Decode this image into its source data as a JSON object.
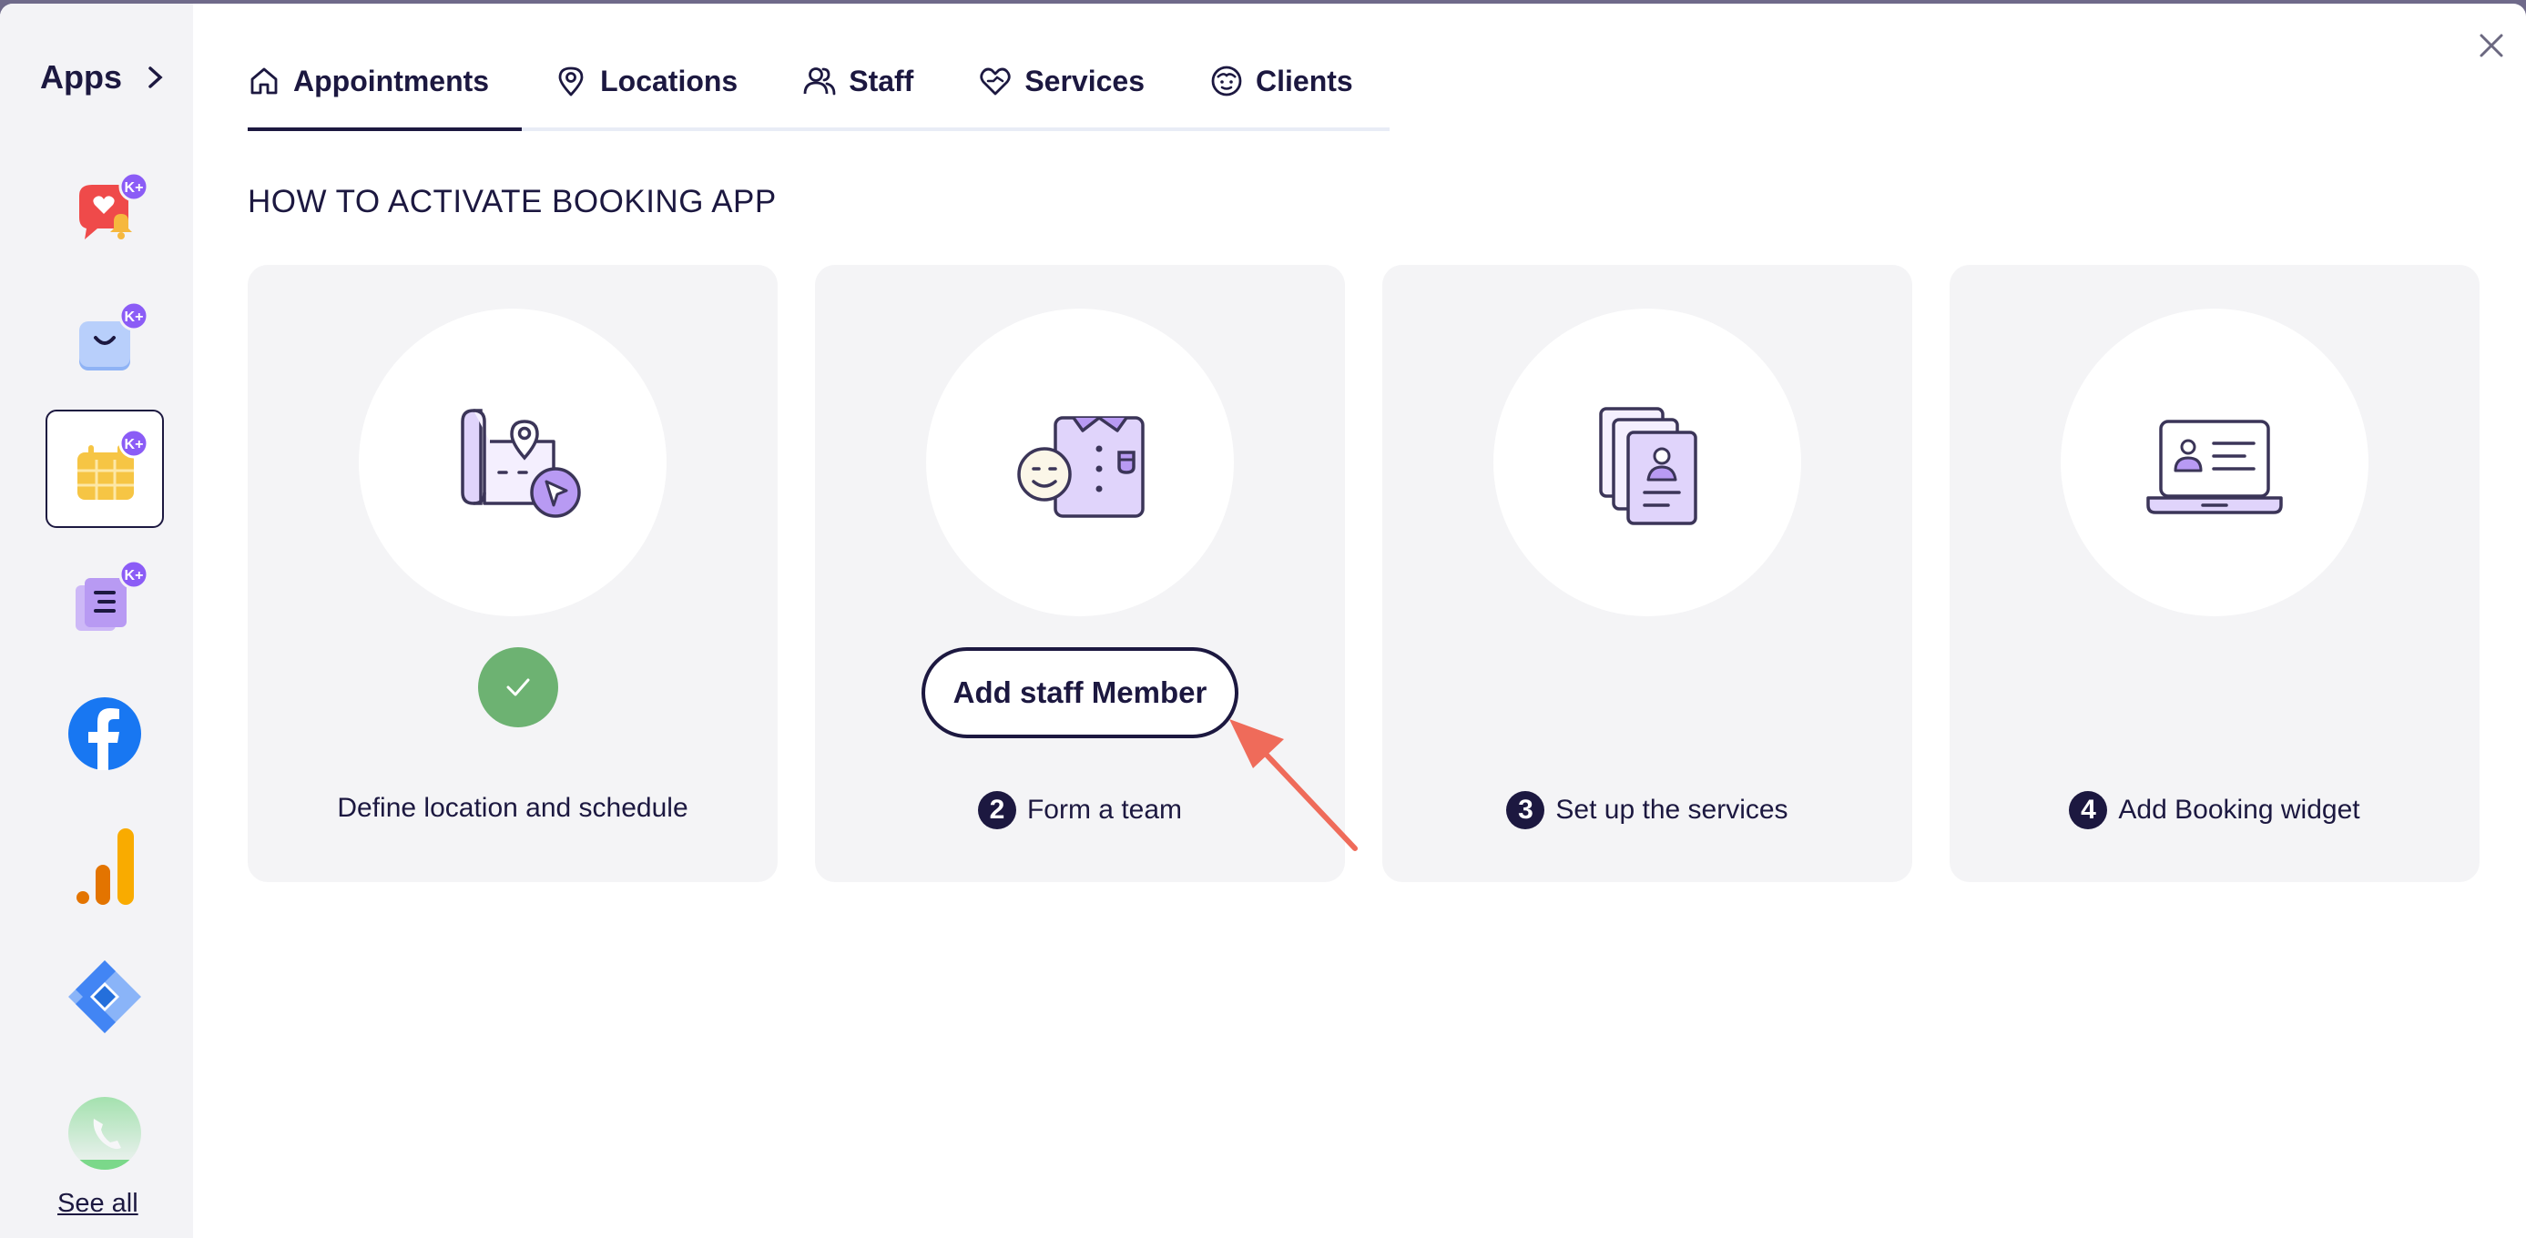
{
  "sidebar": {
    "title": "Apps",
    "see_all": "See all",
    "badge_text": "K+",
    "apps": [
      {
        "icon": "heart-notification-app-icon",
        "badge": true
      },
      {
        "icon": "shopping-bag-app-icon",
        "badge": true
      },
      {
        "icon": "booking-calendar-app-icon",
        "badge": true,
        "active": true
      },
      {
        "icon": "document-list-app-icon",
        "badge": true
      },
      {
        "icon": "facebook-app-icon",
        "badge": false
      },
      {
        "icon": "analytics-app-icon",
        "badge": false
      },
      {
        "icon": "tag-manager-app-icon",
        "badge": false
      },
      {
        "icon": "phone-app-icon",
        "badge": false
      }
    ]
  },
  "tabs": [
    {
      "label": "Appointments",
      "icon": "home-icon",
      "active": true
    },
    {
      "label": "Locations",
      "icon": "location-pin-icon"
    },
    {
      "label": "Staff",
      "icon": "users-icon"
    },
    {
      "label": "Services",
      "icon": "heart-hand-icon"
    },
    {
      "label": "Clients",
      "icon": "smiley-face-icon"
    }
  ],
  "section_title": "HOW TO ACTIVATE BOOKING APP",
  "steps": [
    {
      "label": "Define location and schedule",
      "completed": true
    },
    {
      "number": "2",
      "label": "Form a team",
      "button": "Add staff Member"
    },
    {
      "number": "3",
      "label": "Set up the services"
    },
    {
      "number": "4",
      "label": "Add Booking widget"
    }
  ],
  "colors": {
    "primary": "#1c1840",
    "accent": "#8b5cf6",
    "illustration_fill": "#e0d4fb",
    "success": "#6db272",
    "arrow": "#ef6b5a",
    "card_bg": "#f4f4f6"
  }
}
